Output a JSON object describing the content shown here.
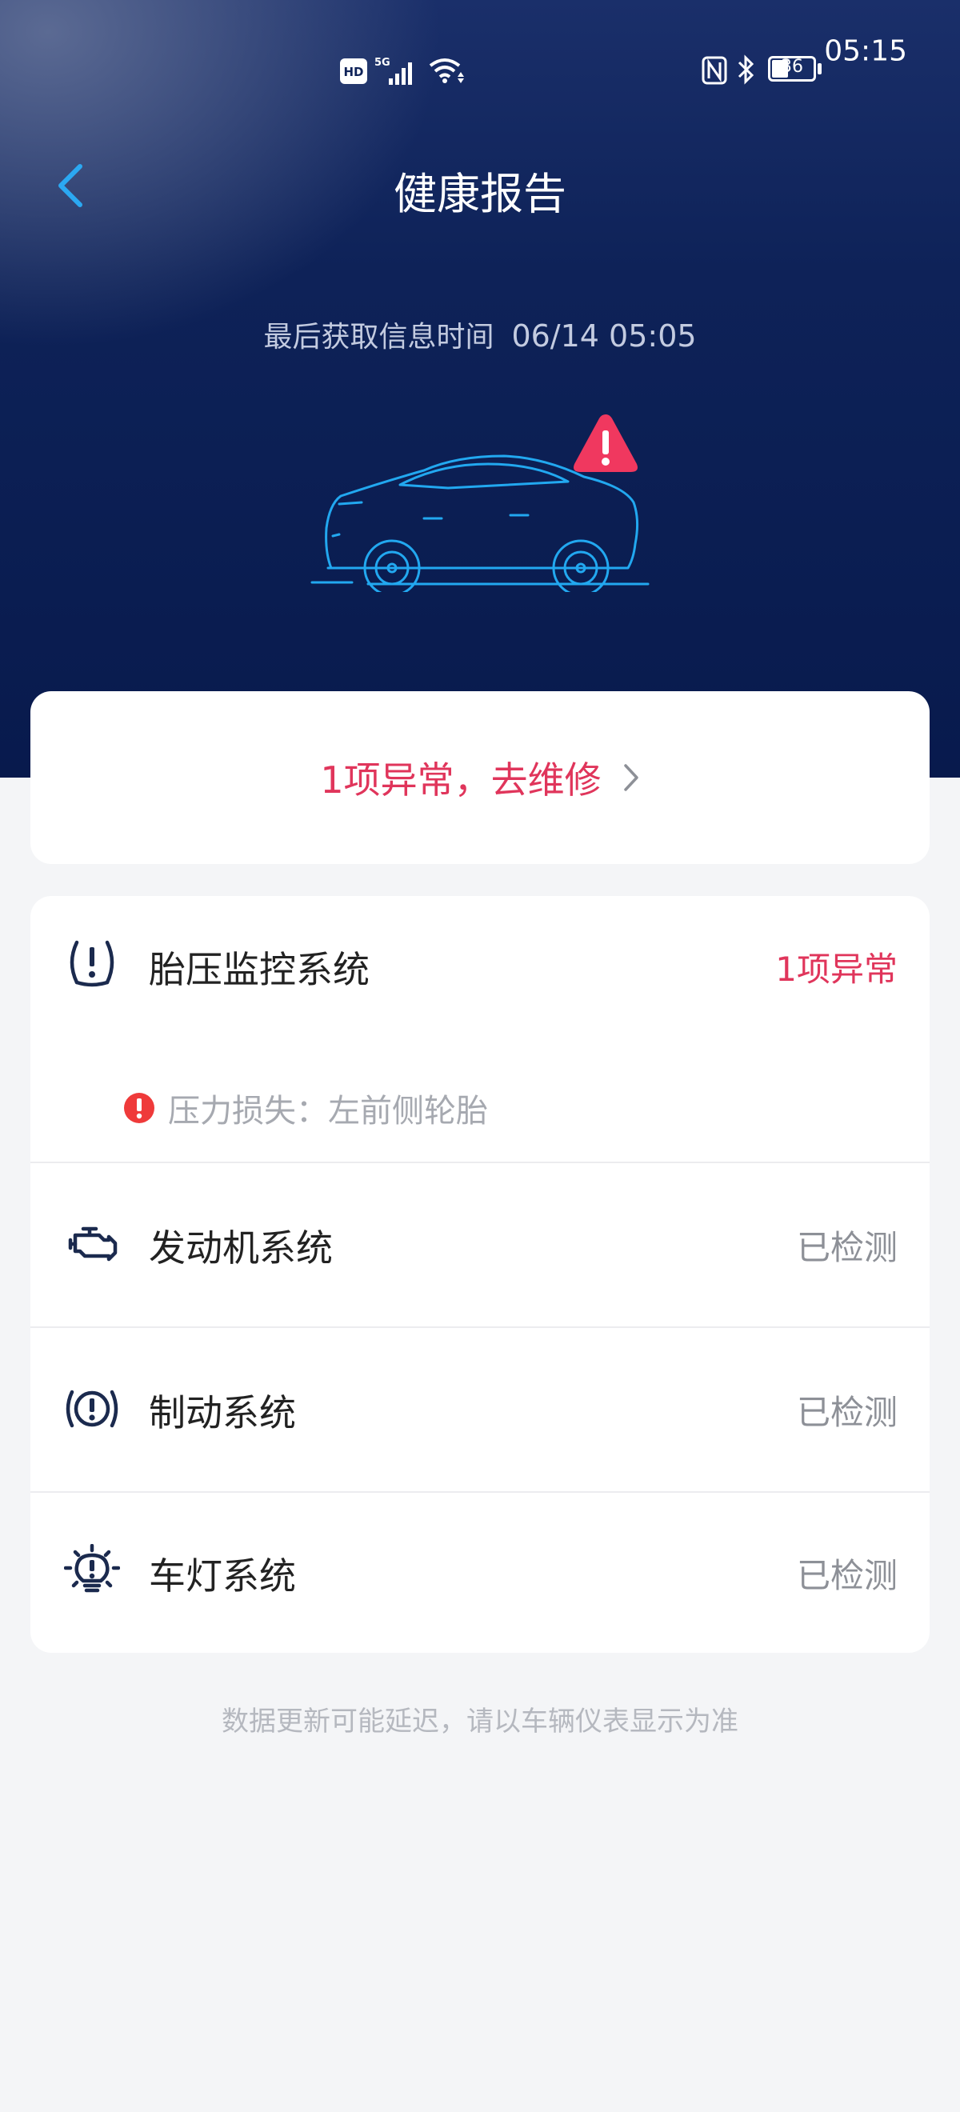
{
  "status_bar": {
    "time": "05:15",
    "battery": "36",
    "signal_label": "5G",
    "hd_label": "HD"
  },
  "header": {
    "title": "健康报告",
    "back_icon": "chevron-left-icon"
  },
  "hero": {
    "update_label": "最后获取信息时间",
    "update_time": "06/14 05:05"
  },
  "repair": {
    "label": "1项异常，去维修"
  },
  "systems": [
    {
      "icon": "tire-pressure-icon",
      "label": "胎压监控系统",
      "status": "1项异常",
      "detail": "压力损失：左前侧轮胎"
    },
    {
      "icon": "engine-icon",
      "label": "发动机系统",
      "status": "已检测"
    },
    {
      "icon": "brake-icon",
      "label": "制动系统",
      "status": "已检测"
    },
    {
      "icon": "light-icon",
      "label": "车灯系统",
      "status": "已检测"
    }
  ],
  "footnote": "数据更新可能延迟，请以车辆仪表显示为准",
  "colors": {
    "alert": "#e0355b",
    "hero_top": "#1a2f6a",
    "hero_bottom": "#081a4d",
    "car_line": "#22a8f0"
  }
}
